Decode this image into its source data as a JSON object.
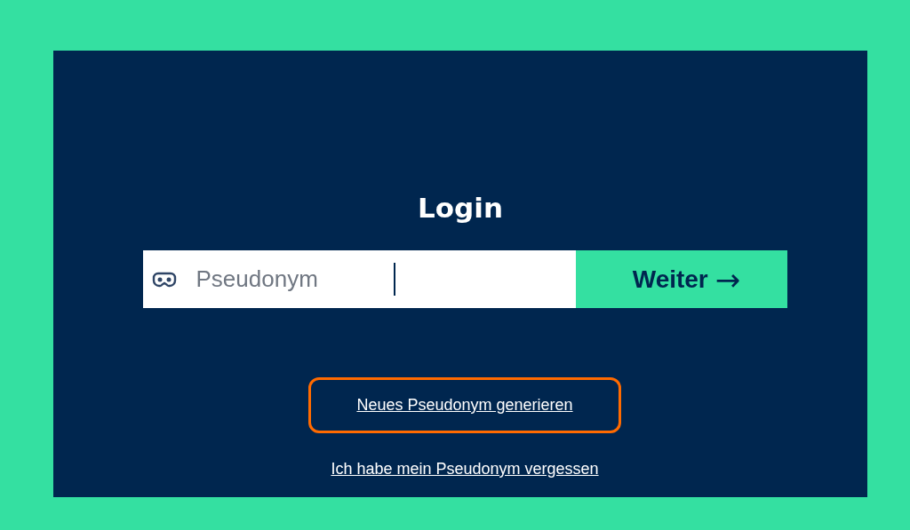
{
  "title": "Login",
  "field": {
    "placeholder": "Pseudonym",
    "focused": true
  },
  "submit": {
    "label": "Weiter",
    "icon": "→"
  },
  "links": [
    {
      "label": "Neues Pseudonym generieren",
      "highlighted": true
    },
    {
      "label": "Ich habe mein Pseudonym vergessen",
      "highlighted": false
    }
  ]
}
